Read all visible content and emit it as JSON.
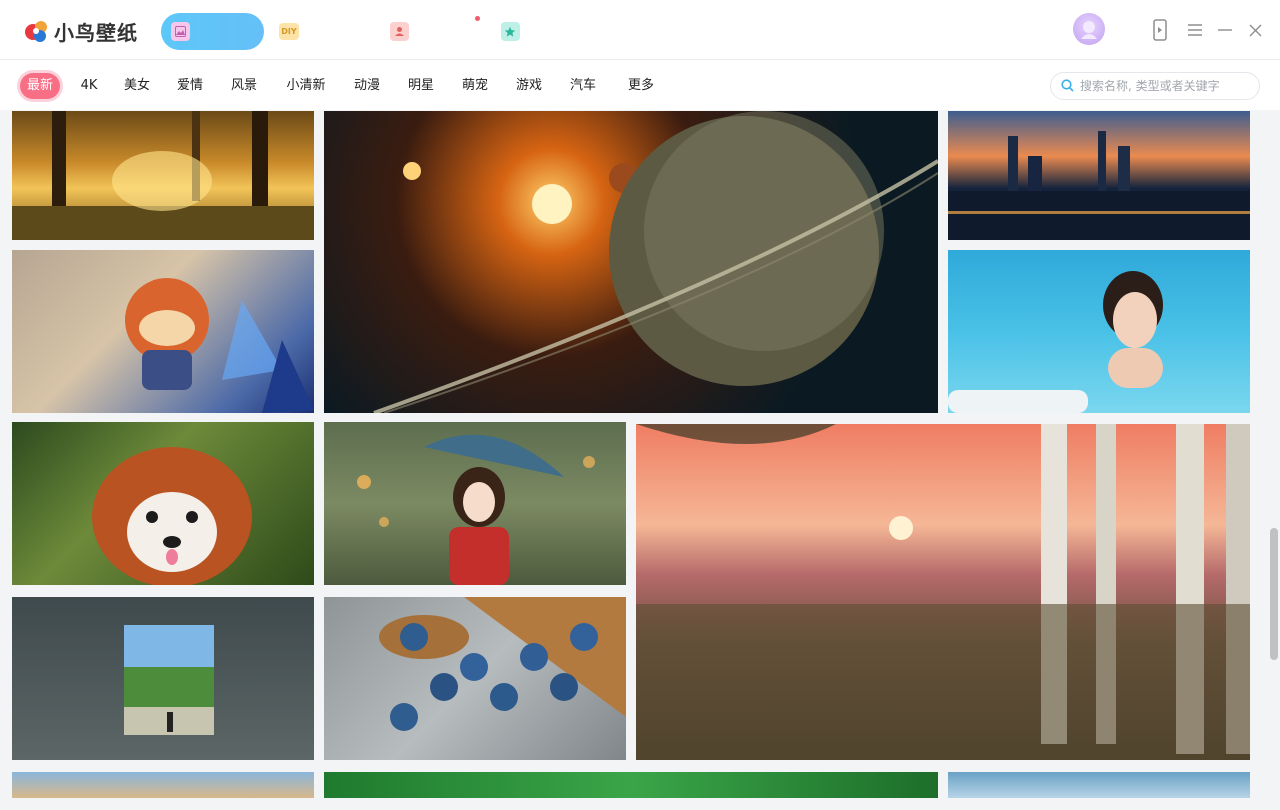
{
  "app": {
    "title": "小鸟壁纸"
  },
  "nav_tabs": [
    {
      "name": "wallpaper",
      "icon": "image-icon",
      "active": true
    },
    {
      "name": "diy",
      "icon": "diy-icon",
      "label": "DIY"
    },
    {
      "name": "profile",
      "icon": "user-icon"
    },
    {
      "name": "favorites",
      "icon": "star-icon"
    }
  ],
  "categories": [
    "最新",
    "4K",
    "美女",
    "爱情",
    "风景",
    "小清新",
    "动漫",
    "明星",
    "萌宠",
    "游戏",
    "汽车",
    "更多"
  ],
  "active_category": "最新",
  "search": {
    "placeholder": "搜索名称, 类型或者关键字"
  },
  "window_controls": [
    "phone-icon",
    "menu-icon",
    "minimize-icon",
    "close-icon"
  ],
  "colors": {
    "accent_blue": "#5cc8f7",
    "accent_pink": "#f86e85"
  }
}
